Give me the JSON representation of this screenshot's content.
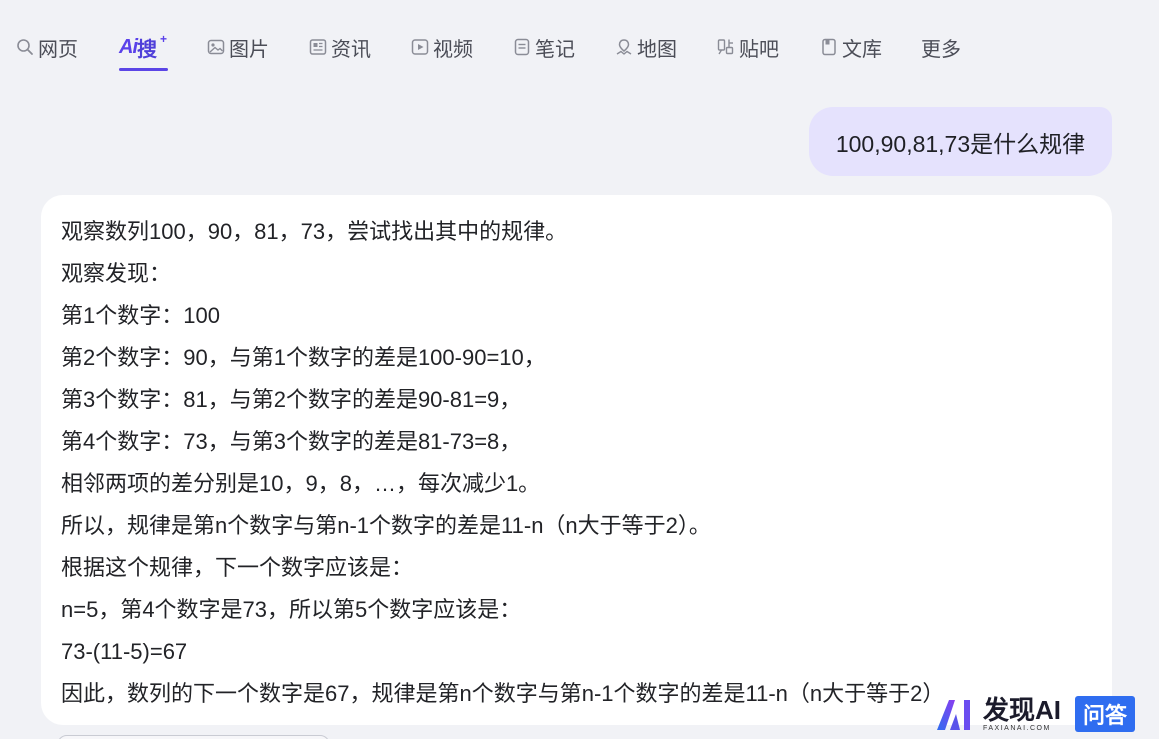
{
  "nav": {
    "tabs": [
      {
        "label": "网页",
        "icon": "search-icon"
      },
      {
        "label": "搜",
        "icon": "ai-logo",
        "logo_text": "Ai",
        "logo_plus": "+"
      },
      {
        "label": "图片",
        "icon": "image-icon"
      },
      {
        "label": "资讯",
        "icon": "news-icon"
      },
      {
        "label": "视频",
        "icon": "video-icon"
      },
      {
        "label": "笔记",
        "icon": "note-icon"
      },
      {
        "label": "地图",
        "icon": "map-icon"
      },
      {
        "label": "贴吧",
        "icon": "tieba-icon"
      },
      {
        "label": "文库",
        "icon": "doc-icon"
      },
      {
        "label": "更多",
        "icon": ""
      }
    ],
    "active_color": "#5b45e6"
  },
  "chat": {
    "question": "100,90,81,73是什么规律",
    "answer_lines": [
      "观察数列100，90，81，73，尝试找出其中的规律。",
      "观察发现：",
      "第1个数字：100",
      "第2个数字：90，与第1个数字的差是100-90=10，",
      "第3个数字：81，与第2个数字的差是90-81=9，",
      "第4个数字：73，与第3个数字的差是81-73=8，",
      "相邻两项的差分别是10，9，8，…，每次减少1。",
      "所以，规律是第n个数字与第n-1个数字的差是11-n（n大于等于2）。",
      "根据这个规律，下一个数字应该是：",
      "n=5，第4个数字是73，所以第5个数字应该是：",
      "73-(11-5)=67",
      "因此，数列的下一个数字是67，规律是第n个数字与第n-1个数字的差是11-n（n大于等于2）"
    ]
  },
  "watermark": {
    "name": "发现AI",
    "url": "FAXIANAI.COM",
    "badge": "问答"
  },
  "colors": {
    "background": "#f1f2f6",
    "user_bubble": "#e5e2fd",
    "answer_card": "#ffffff",
    "accent": "#5b45e6",
    "watermark_badge": "#2f6df0"
  }
}
